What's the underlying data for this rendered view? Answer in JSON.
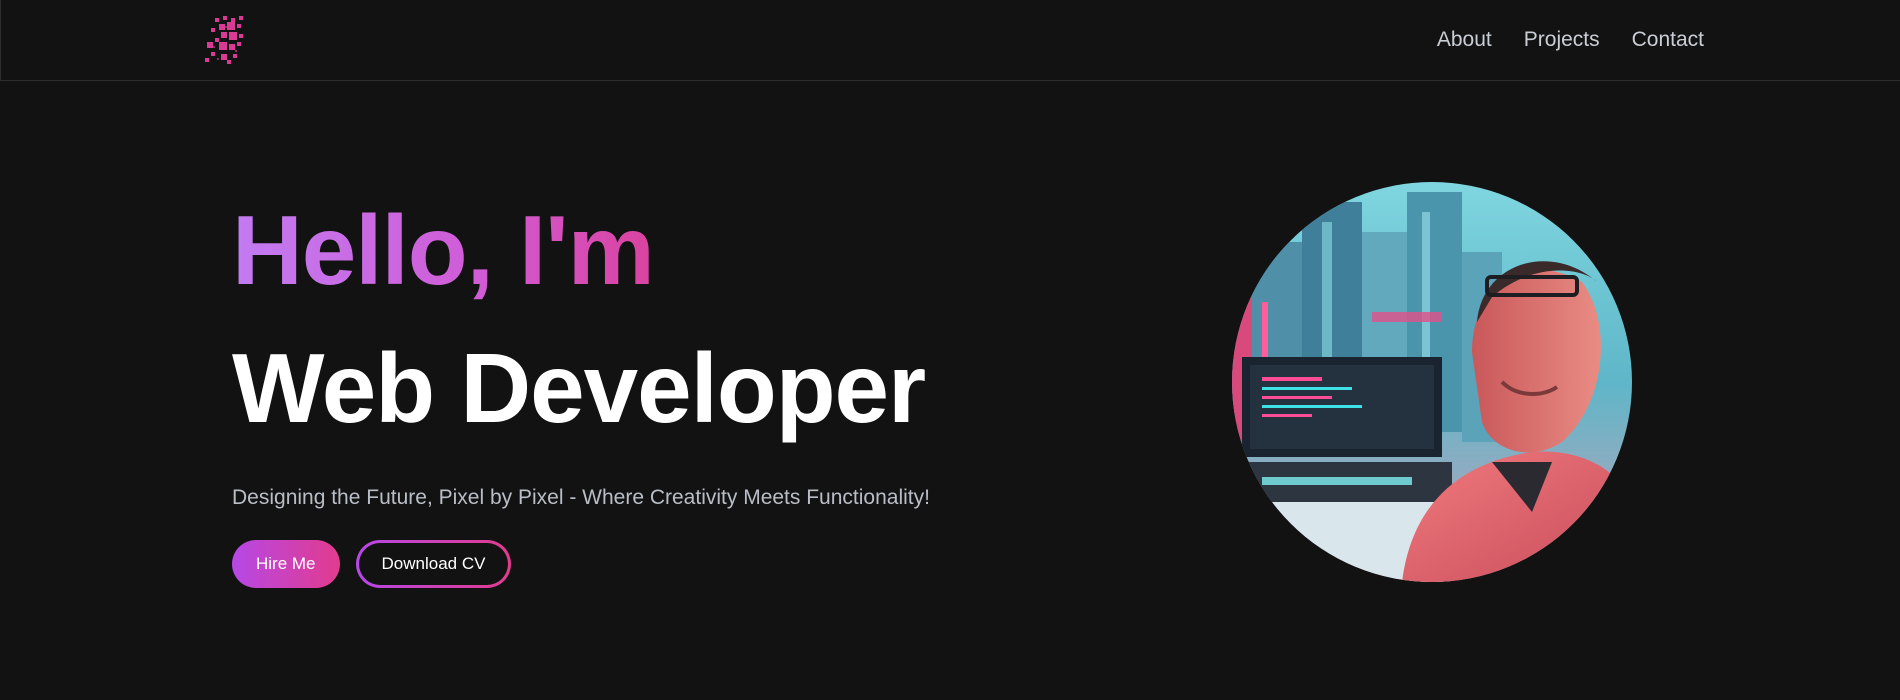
{
  "nav": {
    "logo_icon": "pixel-logo-icon",
    "links": [
      "About",
      "Projects",
      "Contact"
    ]
  },
  "hero": {
    "greeting": "Hello, I'm",
    "role": "Web Developer",
    "tagline": "Designing the Future, Pixel by Pixel - Where Creativity Meets Functionality!",
    "primary_button": "Hire Me",
    "secondary_button": "Download CV",
    "portrait_image": "cyberpunk-developer-portrait"
  },
  "colors": {
    "background": "#121212",
    "accent_purple": "#c27cf2",
    "accent_pink": "#e0347f"
  }
}
